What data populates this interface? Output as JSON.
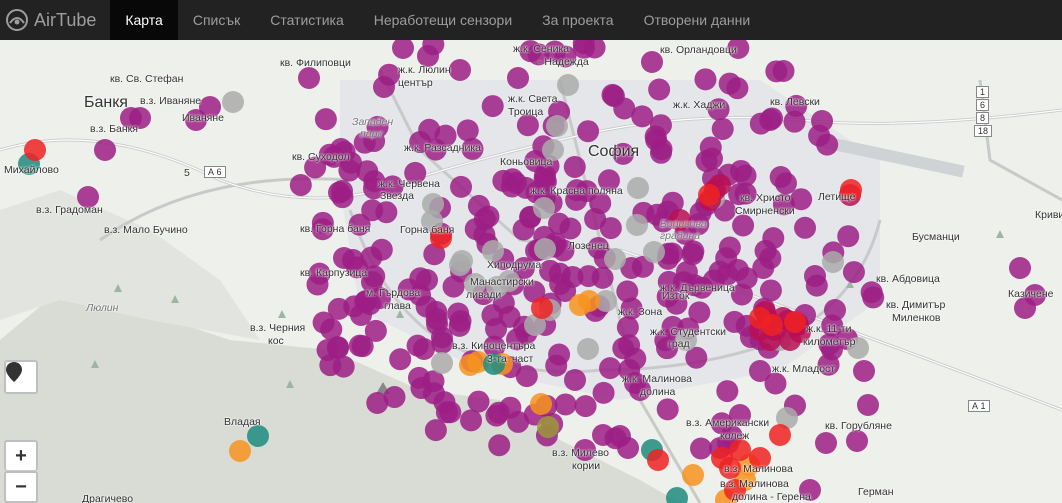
{
  "nav": {
    "brand": "AirTube",
    "items": [
      {
        "id": "map",
        "label": "Карта",
        "active": true
      },
      {
        "id": "list",
        "label": "Списък",
        "active": false
      },
      {
        "id": "stats",
        "label": "Статистика",
        "active": false
      },
      {
        "id": "broken",
        "label": "Неработещи сензори",
        "active": false
      },
      {
        "id": "about",
        "label": "За проекта",
        "active": false
      },
      {
        "id": "open",
        "label": "Отворени данни",
        "active": false
      }
    ]
  },
  "controls": {
    "locate_icon": "location-pin-icon",
    "zoom_in": "+",
    "zoom_out": "−"
  },
  "colors": {
    "purple": "#9c1f85",
    "red": "#ee2222",
    "orange": "#f7931e",
    "yellow": "#e0a030",
    "olive": "#9a9a3a",
    "teal": "#1e8b7e",
    "grey": "#aaaaaa",
    "maroon": "#b80e55"
  },
  "map_labels": [
    "кв. Св. Стефан",
    "кв. Филиповци",
    "ж.к. Люлин",
    "център",
    "ж.к. Света",
    "Троица",
    "ж.к. Сеника",
    "- Надежда",
    "кв. Орландовци",
    "Банкя",
    "в.з. Иваняне",
    "в.з. Банкя",
    "Иваняне",
    "Западен",
    "парк",
    "кв. Суходол",
    "ж.к. Хаджи",
    "кв. Левски",
    "Михайлово",
    "в.з. Градоман",
    "в.з. Мало Бучино",
    "ж.к. Разсадника",
    "Коньовица",
    "София",
    "ж.к. Красна поляна",
    "ж.к. Червена",
    "Звезда",
    "кв. Христо",
    "Смирненски",
    "Летище",
    "Кривина",
    "Бусманци",
    "Горна баня",
    "кв. Горна баня",
    "Лозенец",
    "Борисова",
    "градина",
    "кв. Абдовица",
    "кв. Карпузица",
    "м. Гърдова",
    "глава",
    "Хиподрума",
    "Манастирски",
    "ливади",
    "ж.к. Дървеница",
    "кв. Димитър",
    "Миленков",
    "Казичене",
    "в.з. Черния",
    "кос",
    "Люлин",
    "ж.к. Зона",
    "ж.к. Студентски",
    "град",
    "Изток",
    "ж.к. 11-ти",
    "километър",
    "в.з. Киноцентъра",
    "3-та",
    "част",
    "ж.к. Младост",
    "ж.к. Малинова",
    "долина",
    "в.з. Американски",
    "колеж",
    "кв. Горубляне",
    "в.з. Малинова",
    "Владая",
    "в.з. Милево",
    "кории",
    "в.з. Малинова",
    "долина - Герена",
    "Драгичево",
    "Герман"
  ],
  "road_shields": [
    "А 6",
    "А 1",
    "1",
    "6",
    "8",
    "18",
    "5"
  ],
  "sensors": [
    {
      "level": "purple",
      "count": 301
    },
    {
      "level": "grey",
      "count": 30
    },
    {
      "level": "red",
      "count": 15
    },
    {
      "level": "orange",
      "count": 11
    },
    {
      "level": "teal",
      "count": 5
    },
    {
      "level": "olive",
      "count": 1
    },
    {
      "level": "maroon",
      "count": 14
    }
  ]
}
